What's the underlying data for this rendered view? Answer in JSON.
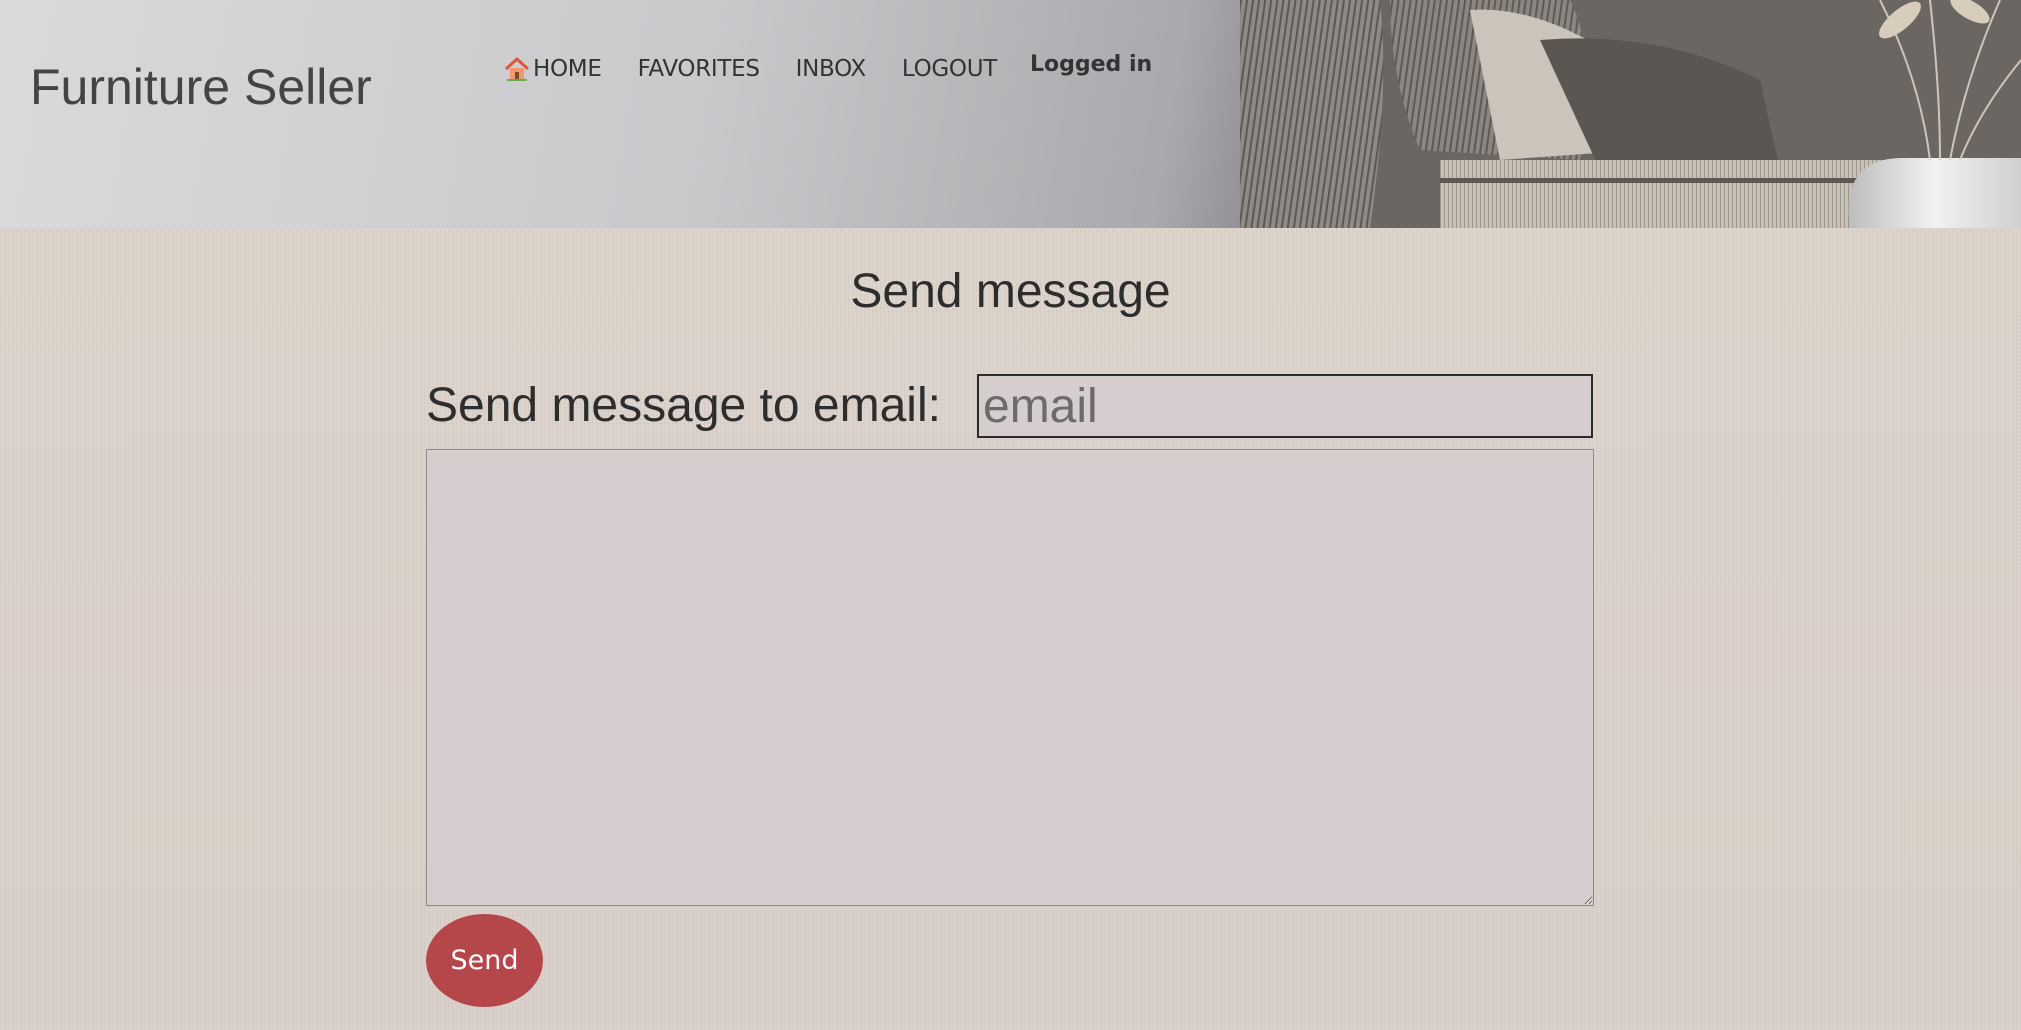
{
  "header": {
    "site_title": "Furniture Seller",
    "nav": [
      {
        "label": "HOME",
        "icon": "home-icon"
      },
      {
        "label": "FAVORITES"
      },
      {
        "label": "INBOX"
      },
      {
        "label": "LOGOUT"
      }
    ],
    "status": "Logged in"
  },
  "main": {
    "heading": "Send message",
    "email_label": "Send message to email:",
    "email_input": {
      "value": "",
      "placeholder": "email"
    },
    "message_textarea": {
      "value": ""
    },
    "send_label": "Send"
  },
  "colors": {
    "accent_button": "#b5474b",
    "input_background": "#d6cdce",
    "page_background": "#d9d1ca"
  }
}
